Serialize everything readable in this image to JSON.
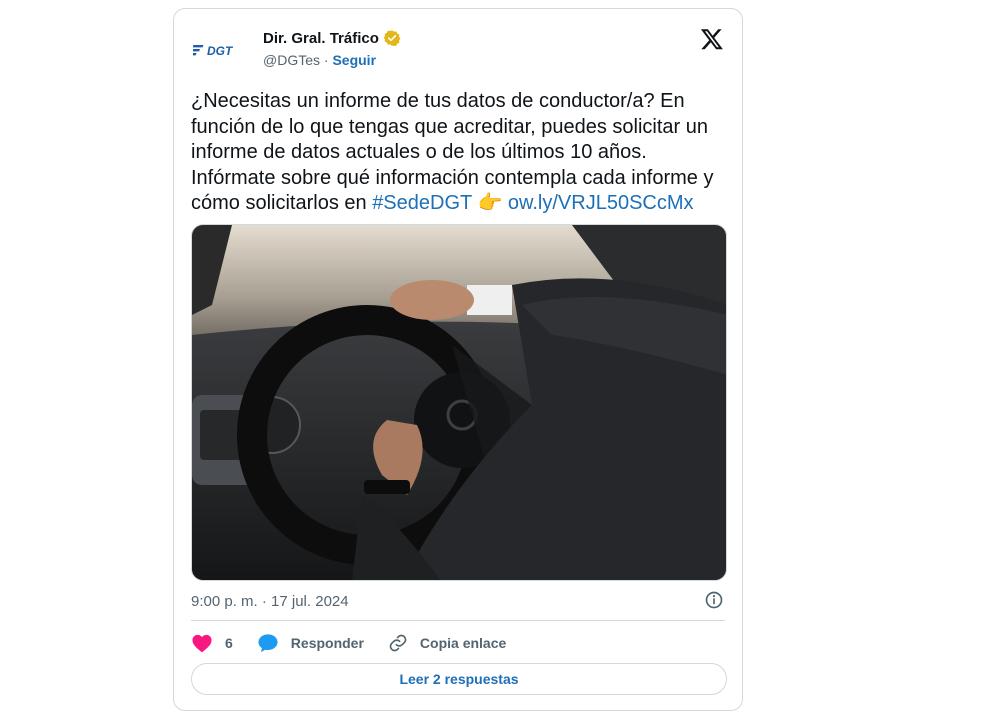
{
  "author": {
    "name": "Dir. Gral. Tráfico",
    "handle": "@DGTes",
    "separator": "·",
    "follow_label": "Seguir",
    "logo_text": "DGT"
  },
  "tweet": {
    "text_main": "¿Necesitas un informe de tus datos de conductor/a? En función de lo que tengas que acreditar, puedes solicitar un informe de datos actuales o de los últimos 10 años. Infórmate sobre qué información contempla cada informe y cómo solicitarlos en ",
    "hashtag": "#SedeDGT",
    "emoji": "👉",
    "link": "ow.ly/VRJL50SCcMx"
  },
  "meta": {
    "timestamp": "9:00 p. m. · 17 jul. 2024"
  },
  "actions": {
    "like_count": "6",
    "reply_label": "Responder",
    "copy_label": "Copia enlace"
  },
  "replies_button": "Leer 2 respuestas",
  "colors": {
    "accent": "#1d6fb8",
    "like": "#f91880",
    "reply_icon": "#1d9bf0",
    "verified": "#e2b719",
    "muted": "#536471"
  },
  "icons": [
    "dgt-logo-icon",
    "verified-badge-icon",
    "x-logo-icon",
    "info-icon",
    "heart-icon",
    "reply-icon",
    "link-icon"
  ]
}
